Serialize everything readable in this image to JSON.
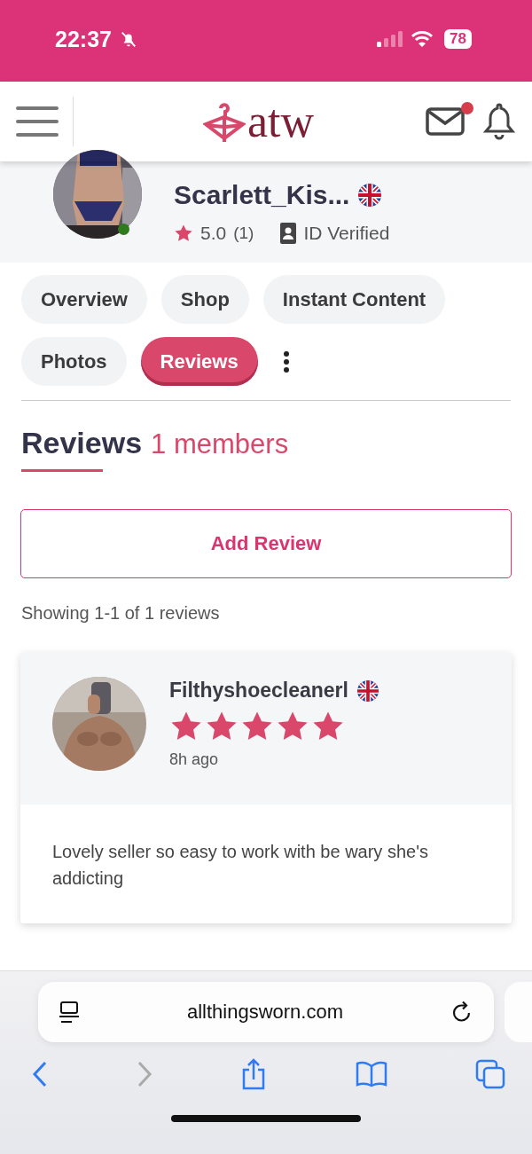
{
  "status_bar": {
    "time": "22:37",
    "battery": "78"
  },
  "header": {
    "logo": "atw",
    "messages_unread": true
  },
  "profile": {
    "username": "Scarlett_Kis...",
    "online": true,
    "rating": "5.0",
    "rating_count": "(1)",
    "verification": "ID Verified"
  },
  "tabs": [
    {
      "label": "Overview",
      "selected": false
    },
    {
      "label": "Shop",
      "selected": false
    },
    {
      "label": "Instant Content",
      "selected": false
    },
    {
      "label": "Photos",
      "selected": false
    },
    {
      "label": "Reviews",
      "selected": true
    }
  ],
  "section": {
    "title": "Reviews",
    "count": "1 members"
  },
  "add_review_button": "Add Review",
  "summary": "Showing 1-1 of 1 reviews",
  "reviews": [
    {
      "author": "Filthyshoecleanerl",
      "stars": 5,
      "time": "8h ago",
      "text": "Lovely seller so easy to work with be wary she's addicting"
    }
  ],
  "browser": {
    "url": "allthingsworn.com"
  }
}
